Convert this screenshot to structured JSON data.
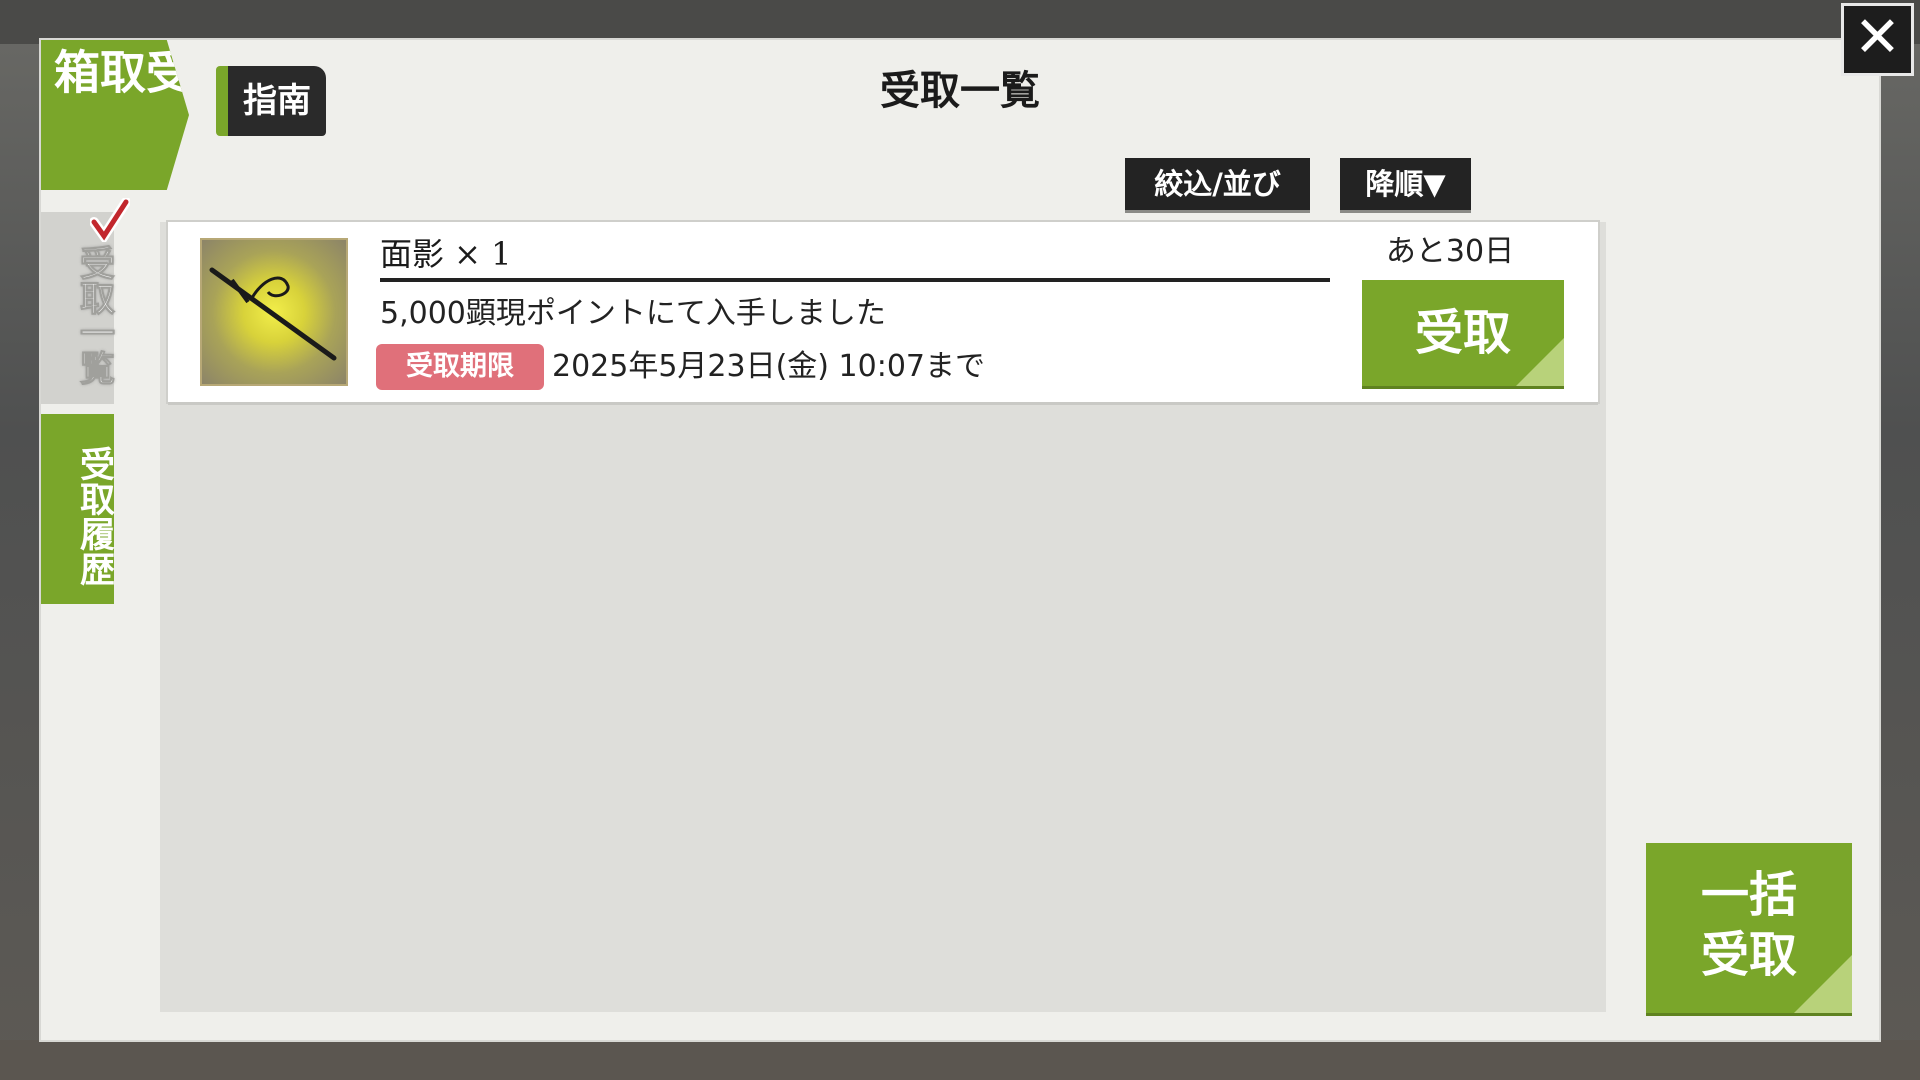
{
  "modal": {
    "section_title": [
      "受",
      "取",
      "箱"
    ],
    "guide_label": "指南",
    "title": "受取一覧",
    "filter_label": "絞込/並び",
    "sort_label": "降順▼",
    "close_label": "✕"
  },
  "sidebar": {
    "tabs": [
      {
        "label": "受取一覧",
        "active": true
      },
      {
        "label": "受取履歴",
        "active": false
      }
    ]
  },
  "items": [
    {
      "name": "面影 × 1",
      "description": "5,000顕現ポイントにて入手しました",
      "deadline_label": "受取期限",
      "deadline": "2025年5月23日(金) 10:07まで",
      "remaining": "あと30日",
      "receive_label": "受取",
      "icon": "sword-icon"
    }
  ],
  "bulk": {
    "line1": "一括",
    "line2": "受取"
  },
  "colors": {
    "accent_green": "#7aa62a",
    "badge_red": "#e0707a",
    "dark": "#232323"
  }
}
